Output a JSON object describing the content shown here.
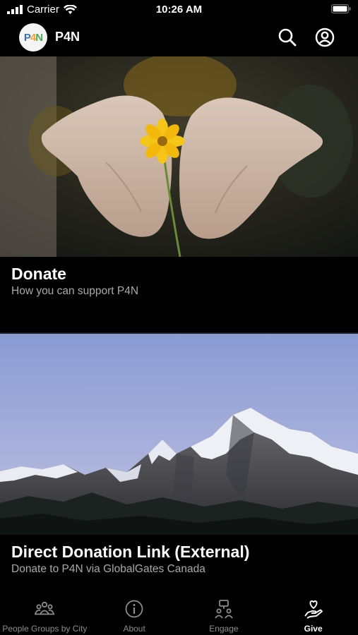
{
  "status_bar": {
    "carrier": "Carrier",
    "time": "10:26 AM"
  },
  "header": {
    "logo_text": {
      "p": "P",
      "four": "4",
      "n": "N"
    },
    "title": "P4N"
  },
  "cards": [
    {
      "title": "Donate",
      "subtitle": "How you can support P4N"
    },
    {
      "title": "Direct Donation Link (External)",
      "subtitle": "Donate to P4N via GlobalGates Canada"
    }
  ],
  "tabs": [
    {
      "label": "People Groups by City",
      "icon": "people-group-icon"
    },
    {
      "label": "About",
      "icon": "info-icon"
    },
    {
      "label": "Engage",
      "icon": "engage-icon"
    },
    {
      "label": "Give",
      "icon": "give-hand-heart-icon",
      "active": true
    }
  ],
  "colors": {
    "background": "#000000",
    "subtitle": "#a9a9a9",
    "tab_inactive": "#8c8c8c",
    "tab_active": "#ffffff",
    "flower": "#f5c518"
  }
}
